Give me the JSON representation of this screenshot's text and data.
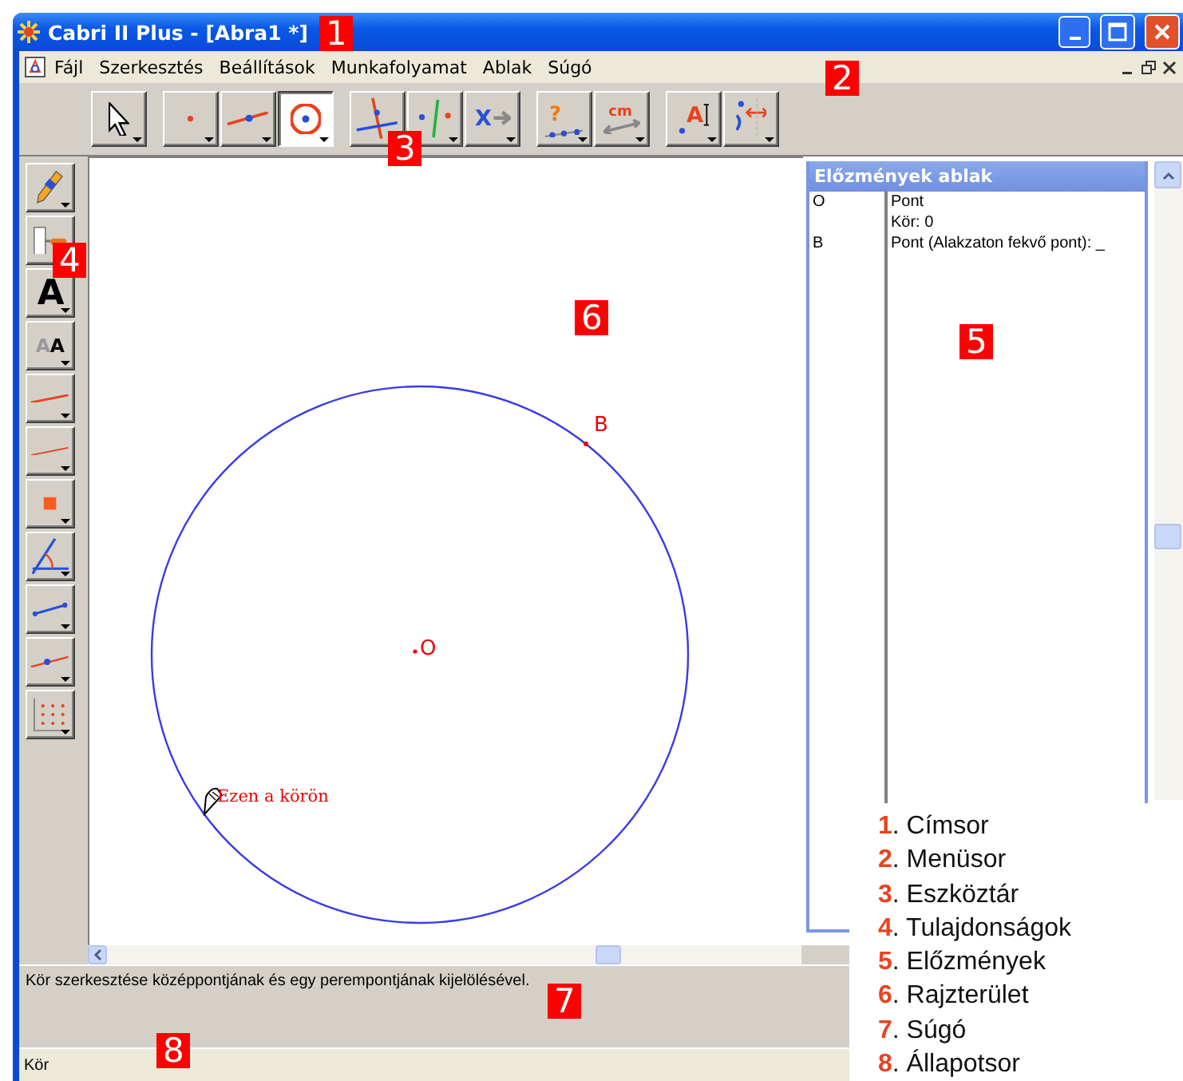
{
  "window": {
    "title": "Cabri II Plus - [Abra1 *]"
  },
  "menu": [
    {
      "label": "Fájl"
    },
    {
      "label": "Szerkesztés"
    },
    {
      "label": "Beállítások"
    },
    {
      "label": "Munkafolyamat"
    },
    {
      "label": "Ablak"
    },
    {
      "label": "Súgó"
    }
  ],
  "toolbar": {
    "groups": [
      {
        "tools": [
          {
            "kind": "pointer",
            "selected": false
          }
        ]
      },
      {
        "tools": [
          {
            "kind": "point",
            "selected": false
          },
          {
            "kind": "line",
            "selected": false
          },
          {
            "kind": "circle",
            "selected": true
          }
        ]
      },
      {
        "tools": [
          {
            "kind": "perpendicular",
            "selected": false
          },
          {
            "kind": "parallel",
            "selected": false
          },
          {
            "kind": "transform",
            "glyph": "X",
            "selected": false
          }
        ]
      },
      {
        "tools": [
          {
            "kind": "check",
            "glyph": "?",
            "selected": false
          },
          {
            "kind": "measure",
            "glyph": "cm",
            "selected": false
          }
        ]
      },
      {
        "tools": [
          {
            "kind": "label",
            "glyph": "A",
            "selected": false
          },
          {
            "kind": "symmetry",
            "selected": false
          }
        ]
      }
    ]
  },
  "attribute_tools": [
    {
      "kind": "pencil"
    },
    {
      "kind": "roller"
    },
    {
      "kind": "text-style",
      "glyph": "A"
    },
    {
      "kind": "text-size",
      "glyph": "AA"
    },
    {
      "kind": "thick-line"
    },
    {
      "kind": "thin-line"
    },
    {
      "kind": "square"
    },
    {
      "kind": "angle"
    },
    {
      "kind": "segment"
    },
    {
      "kind": "line-point"
    },
    {
      "kind": "grid"
    }
  ],
  "canvas": {
    "points": [
      {
        "label": "O"
      },
      {
        "label": "B"
      }
    ],
    "hint": "Ezen a körön"
  },
  "history": {
    "title": "Előzmények ablak",
    "lines": [
      {
        "name": "O",
        "text": "Pont"
      },
      {
        "text": "Kör: 0"
      },
      {
        "name": "B",
        "text": "Pont (Alakzaton fekvő pont): _"
      }
    ]
  },
  "help_text": "Kör szerkesztése középpontjának és egy perempontjának kijelölésével.",
  "status_bar": "Kör",
  "callouts": [
    {
      "label": "1"
    },
    {
      "label": "2"
    },
    {
      "label": "3"
    },
    {
      "label": "4"
    },
    {
      "label": "5"
    },
    {
      "label": "6"
    },
    {
      "label": "7"
    },
    {
      "label": "8"
    }
  ],
  "legend": [
    {
      "text": "**1**. Címsor"
    },
    {
      "text": "**2**. Menüsor"
    },
    {
      "text": "**3**. Eszköztár"
    },
    {
      "text": "**4**. Tulajdonságok"
    },
    {
      "text": "**5**. Előzmények"
    },
    {
      "text": "**6**. Rajzterület"
    },
    {
      "text": "**7**. Súgó"
    },
    {
      "text": "**8**. Állapotsor"
    }
  ]
}
